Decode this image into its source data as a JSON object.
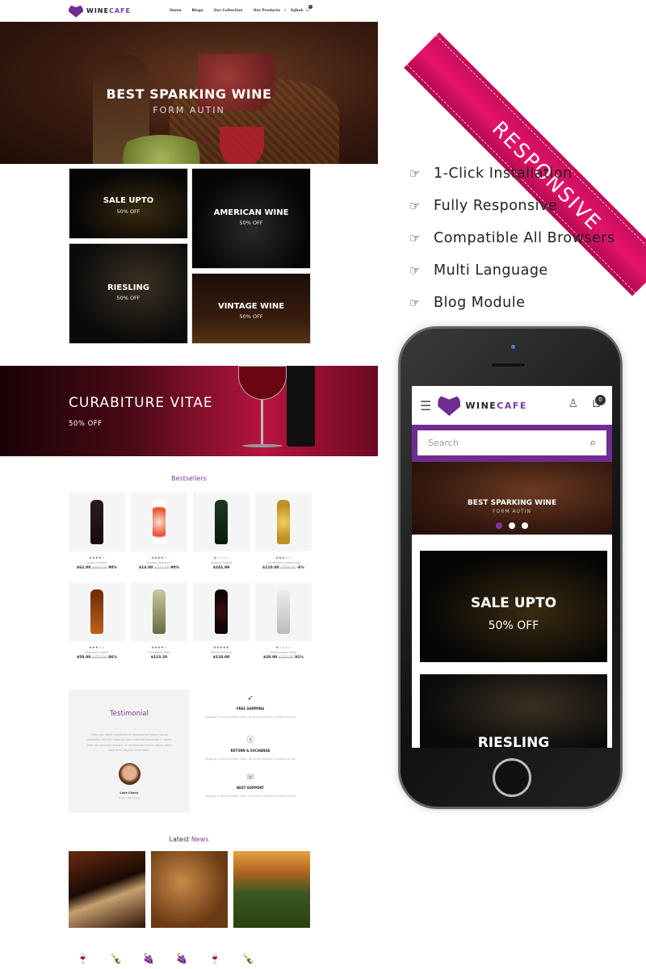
{
  "header": {
    "brand_main": "WINE",
    "brand_accent": "CAFE",
    "nav": [
      "Home",
      "Blogs",
      "Our Collection",
      "Our Products",
      "Synah"
    ],
    "cart_count": "0"
  },
  "hero": {
    "title": "BEST SPARKING WINE",
    "subtitle": "FORM AUTIN"
  },
  "banners": [
    {
      "title": "SALE UPTO",
      "subtitle": "50% OFF"
    },
    {
      "title": "AMERICAN WINE",
      "subtitle": "50% OFF"
    },
    {
      "title": "RIESLING",
      "subtitle": "50% OFF"
    },
    {
      "title": "VINTAGE WINE",
      "subtitle": "50% OFF"
    }
  ],
  "promo": {
    "title": "CURABITURE VITAE",
    "subtitle": "50% OFF"
  },
  "bestsellers": {
    "title": "Bestsellers",
    "products": [
      {
        "name": "Dapibus Tortor",
        "stars": "★★★★☆",
        "price": "$62.00",
        "old": "$602.00",
        "disc": "90%"
      },
      {
        "name": "Aenean Dignissim",
        "stars": "★★★★☆",
        "price": "$14.00",
        "old": "$122.00",
        "disc": "90%"
      },
      {
        "name": "Tempus Magna",
        "stars": "★☆☆☆☆",
        "price": "$241.99",
        "old": "",
        "disc": ""
      },
      {
        "name": "Consectetur Adipiscing",
        "stars": "★★★☆☆",
        "price": "$110.00",
        "old": "$104.00",
        "disc": "-6%"
      },
      {
        "name": "Dignissim Ligula",
        "stars": "★★★☆☆",
        "price": "$50.00",
        "old": "$355.00",
        "disc": "86%"
      },
      {
        "name": "Consequat Nibh",
        "stars": "★★★★☆",
        "price": "$123.20",
        "old": "",
        "disc": ""
      },
      {
        "name": "Donec Pulvinar",
        "stars": "★★★★★",
        "price": "$110.00",
        "old": "",
        "disc": ""
      },
      {
        "name": "Pellentesque Nisoi",
        "stars": "★☆☆☆☆",
        "price": "$20.00",
        "old": "$206.00",
        "disc": "91%"
      }
    ]
  },
  "testimonial": {
    "title": "Testimonial",
    "text": "There are many variations of passages of Lorem Ipsum available, but the majority have suffered alteration in some form, by injected humour, or randomised words which don't look even slightly believable.",
    "name": "Luke Charly",
    "role": "Iphone Developer"
  },
  "services": [
    {
      "icon": "rocket-icon",
      "glyph": "🚀",
      "title": "FREE SHIPPING",
      "desc": "Shipping & returns hidden costs - all prices inclusive of duties and tax"
    },
    {
      "icon": "dollar-icon",
      "glyph": "$",
      "title": "RETURN & EXCHANGE",
      "desc": "Shipping & returns hidden costs - all prices inclusive of duties and tax"
    },
    {
      "icon": "phone-icon",
      "glyph": "☏",
      "title": "BEST SUPPORT",
      "desc": "Shipping & returns hidden costs - all prices inclusive of duties and tax"
    }
  ],
  "news": {
    "title_a": "Latest ",
    "title_b": "News"
  },
  "brands": [
    "WINE",
    "WINE",
    "WINE",
    "WINE",
    "WINE",
    "WINE"
  ],
  "ribbon": "RESPONSIVE",
  "features": [
    "1-Click Installation",
    "Fully Responsive",
    "Compatible All Browsers",
    "Multi Language",
    "Blog Module"
  ],
  "mobile": {
    "brand_main": "WINE",
    "brand_accent": "CAFE",
    "cart_count": "0",
    "search_placeholder": "Search",
    "hero_title": "BEST SPARKING WINE",
    "hero_subtitle": "FORM AUTIN",
    "banner1_title": "SALE UPTO",
    "banner1_sub": "50% OFF",
    "banner2_title": "RIESLING"
  },
  "colors": {
    "brand": "#7a3aa2",
    "ribbon": "#d8105e"
  }
}
